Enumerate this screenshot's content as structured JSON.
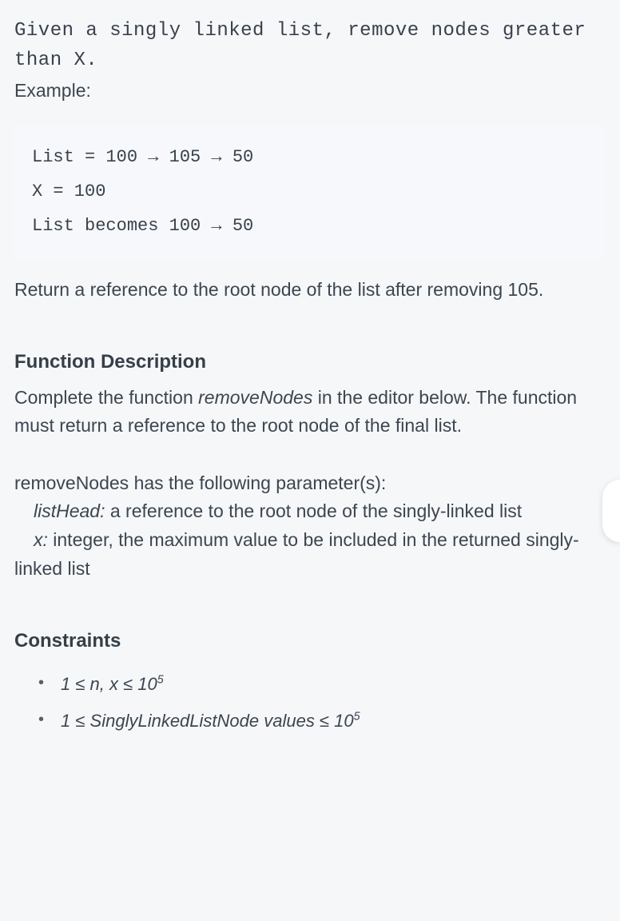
{
  "intro": {
    "code_line": "Given a singly linked list, remove nodes greater than X.",
    "example_label": "Example:"
  },
  "codeblock": "List = 100 → 105 → 50\nX = 100\nList becomes 100 → 50",
  "after_code": "Return a reference to the root node of the list after removing 105.",
  "func_desc": {
    "heading": "Function Description",
    "body_pre": "Complete the function ",
    "func_name": "removeNodes",
    "body_post": " in the editor below. The function must return a reference to the root node of the final list."
  },
  "params": {
    "lead": "removeNodes has the following parameter(s):",
    "p1_name": "listHead:",
    "p1_desc": "  a reference to the root node of the singly-linked list",
    "p2_name": "x:",
    "p2_desc": "  integer, the maximum value to be included in the returned singly-linked list"
  },
  "constraints": {
    "heading": "Constraints",
    "c1_pre": "1 ≤ n, x ≤ 10",
    "c1_sup": "5",
    "c2_pre": "1 ≤ SinglyLinkedListNode values ≤ 10",
    "c2_sup": "5"
  }
}
